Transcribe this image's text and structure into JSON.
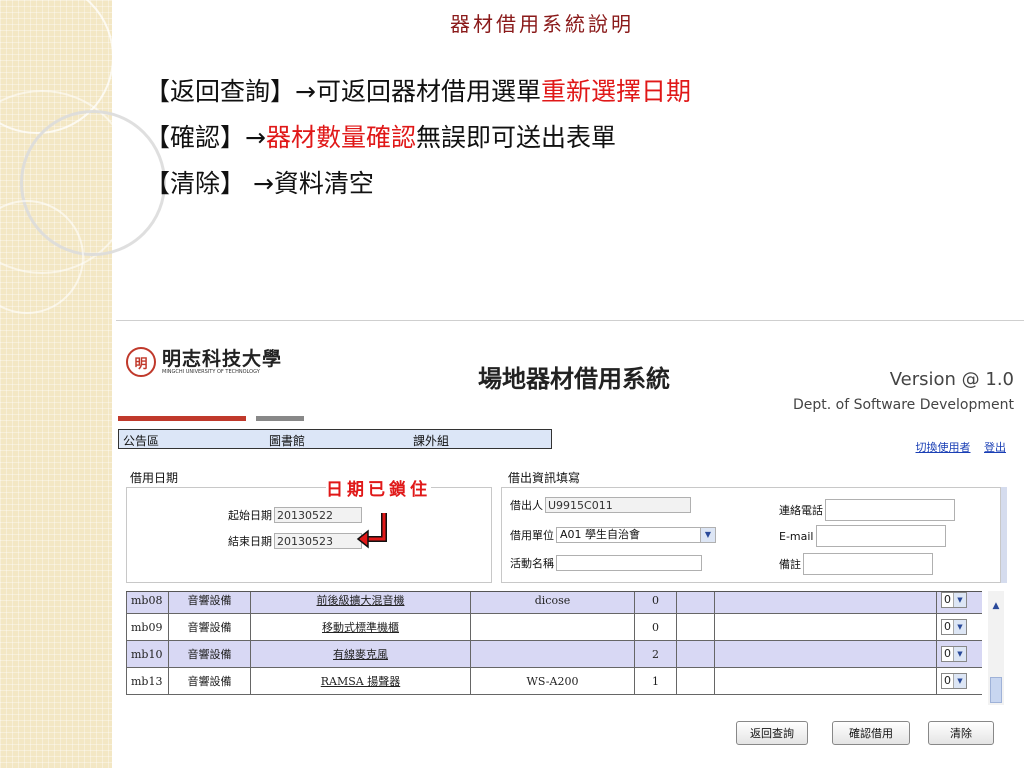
{
  "slide": {
    "title": "器材借用系統說明",
    "lines": [
      {
        "prefix": "【返回查詢】→可返回器材借用選單",
        "highlight": "重新選擇日期",
        "suffix": ""
      },
      {
        "prefix": "【確認】→",
        "highlight": "器材數量確認",
        "suffix": "無誤即可送出表單"
      },
      {
        "prefix": "【清除】 →資料清空",
        "highlight": "",
        "suffix": ""
      }
    ],
    "accent_red": "#e01818"
  },
  "app": {
    "logo_zh": "明志科技大學",
    "logo_en": "MINGCHI UNIVERSITY OF TECHNOLOGY",
    "title": "場地器材借用系統",
    "version": "Version @ 1.0",
    "dept": "Dept. of Software Development",
    "nav": [
      "公告區",
      "圖書館",
      "課外組"
    ],
    "top_links": [
      "切換使用者",
      "登出"
    ],
    "borrow_date_label": "借用日期",
    "locked_note": "日期已鎖住",
    "start_date_label": "起始日期",
    "start_date_value": "20130522",
    "end_date_label": "結束日期",
    "end_date_value": "20130523",
    "borrower_section_label": "借出資訊填寫",
    "borrower_label": "借出人",
    "borrower_value": "U9915C011",
    "unit_label": "借用單位",
    "unit_value": "A01 學生自治會",
    "activity_label": "活動名稱",
    "activity_value": "",
    "phone_label": "連絡電話",
    "email_label": "E-mail",
    "note_label": "備註",
    "rows": [
      {
        "id": "mb08",
        "category": "音響設備",
        "name": "前後級擴大混音機",
        "model": "dicose",
        "stock": "0",
        "qty": "0"
      },
      {
        "id": "mb09",
        "category": "音響設備",
        "name": "移動式標準機櫃",
        "model": "",
        "stock": "0",
        "qty": "0"
      },
      {
        "id": "mb10",
        "category": "音響設備",
        "name": "有線麥克風",
        "model": "",
        "stock": "2",
        "qty": "0"
      },
      {
        "id": "mb13",
        "category": "音響設備",
        "name": "RAMSA 揚聲器",
        "model": "WS-A200",
        "stock": "1",
        "qty": "0"
      }
    ],
    "buttons": {
      "back": "返回查詢",
      "confirm": "確認借用",
      "clear": "清除"
    }
  }
}
